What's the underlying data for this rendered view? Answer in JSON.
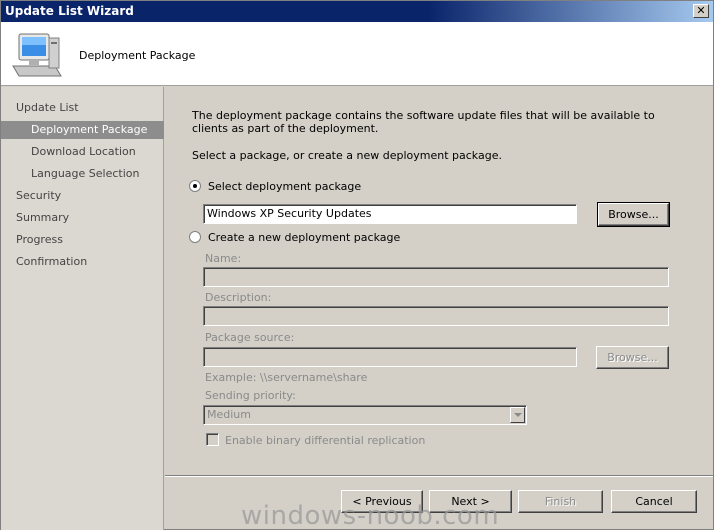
{
  "window": {
    "title": "Update List Wizard",
    "close_label": "✕"
  },
  "header": {
    "title": "Deployment Package",
    "icon": "computer-icon"
  },
  "sidebar": {
    "items": [
      {
        "label": "Update List"
      },
      {
        "label": "Deployment Package"
      },
      {
        "label": "Download Location"
      },
      {
        "label": "Language Selection"
      },
      {
        "label": "Security"
      },
      {
        "label": "Summary"
      },
      {
        "label": "Progress"
      },
      {
        "label": "Confirmation"
      }
    ]
  },
  "main": {
    "intro": "The deployment package contains the software update files that will be available to clients as part of the deployment.",
    "instruction": "Select a package, or create a new deployment package.",
    "select_option": {
      "label": "Select deployment package",
      "value": "Windows XP Security Updates",
      "browse_label": "Browse..."
    },
    "create_option": {
      "label": "Create a new deployment package",
      "name_label": "Name:",
      "name_value": "",
      "description_label": "Description:",
      "description_value": "",
      "source_label": "Package source:",
      "source_value": "",
      "browse_label": "Browse...",
      "example": "Example: \\\\servername\\share",
      "priority_label": "Sending priority:",
      "priority_value": "Medium",
      "binary_label": "Enable binary differential replication"
    }
  },
  "footer": {
    "previous_label": "< Previous",
    "next_label": "Next >",
    "finish_label": "Finish",
    "cancel_label": "Cancel"
  },
  "watermark": "windows-noob.com"
}
